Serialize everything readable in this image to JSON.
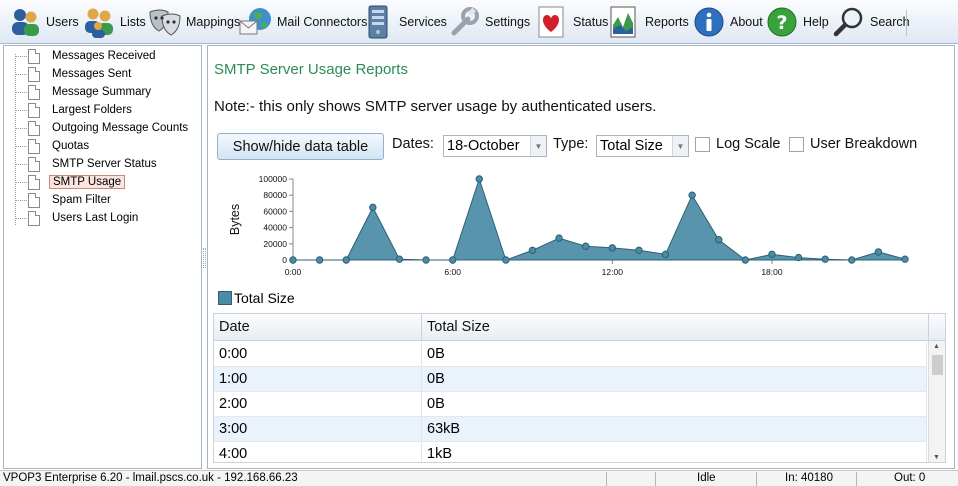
{
  "toolbar": {
    "items": [
      {
        "label": "Users",
        "icon": "users-icon"
      },
      {
        "label": "Lists",
        "icon": "lists-icon"
      },
      {
        "label": "Mappings",
        "icon": "masks-icon"
      },
      {
        "label": "Mail Connectors",
        "icon": "globe-mail-icon"
      },
      {
        "label": "Services",
        "icon": "server-icon"
      },
      {
        "label": "Settings",
        "icon": "wrench-icon"
      },
      {
        "label": "Status",
        "icon": "heart-icon"
      },
      {
        "label": "Reports",
        "icon": "report-chart-icon"
      },
      {
        "label": "About",
        "icon": "info-icon"
      },
      {
        "label": "Help",
        "icon": "help-icon"
      },
      {
        "label": "Search",
        "icon": "magnifier-icon"
      }
    ]
  },
  "tree": {
    "items": [
      {
        "label": "Messages Received"
      },
      {
        "label": "Messages Sent"
      },
      {
        "label": "Message Summary"
      },
      {
        "label": "Largest Folders"
      },
      {
        "label": "Outgoing Message Counts"
      },
      {
        "label": "Quotas"
      },
      {
        "label": "SMTP Server Status"
      },
      {
        "label": "SMTP Usage",
        "selected": true
      },
      {
        "label": "Spam Filter"
      },
      {
        "label": "Users Last Login"
      }
    ]
  },
  "main": {
    "title": "SMTP Server Usage Reports",
    "note": "Note:- this only shows SMTP server usage by authenticated users.",
    "toggle_button": "Show/hide data table",
    "dates_label": "Dates:",
    "dates_value": "18-October",
    "type_label": "Type:",
    "type_value": "Total Size",
    "log_scale_label": "Log Scale",
    "user_breakdown_label": "User Breakdown"
  },
  "chart_data": {
    "type": "area",
    "ylabel": "Bytes",
    "xlabel": "",
    "x_tick_labels": [
      "0:00",
      "6:00",
      "12:00",
      "18:00"
    ],
    "y_tick_labels": [
      "0",
      "20000",
      "40000",
      "60000",
      "80000",
      "100000"
    ],
    "ylim": [
      0,
      100000
    ],
    "legend_position": "bottom-left",
    "series": [
      {
        "name": "Total Size",
        "color": "#4a8ca6",
        "x": [
          "0:00",
          "1:00",
          "2:00",
          "3:00",
          "4:00",
          "5:00",
          "6:00",
          "7:00",
          "8:00",
          "9:00",
          "10:00",
          "11:00",
          "12:00",
          "13:00",
          "14:00",
          "15:00",
          "16:00",
          "17:00",
          "18:00",
          "19:00",
          "20:00",
          "21:00",
          "22:00",
          "23:00"
        ],
        "values": [
          0,
          0,
          0,
          65000,
          1000,
          0,
          0,
          100000,
          0,
          12000,
          27000,
          17000,
          15000,
          12000,
          7000,
          80000,
          25000,
          0,
          7000,
          3000,
          1000,
          0,
          10000,
          1000
        ]
      }
    ]
  },
  "table": {
    "headers": [
      "Date",
      "Total Size"
    ],
    "rows": [
      [
        "0:00",
        "0B"
      ],
      [
        "1:00",
        "0B"
      ],
      [
        "2:00",
        "0B"
      ],
      [
        "3:00",
        "63kB"
      ],
      [
        "4:00",
        "1kB"
      ]
    ]
  },
  "statusbar": {
    "app_info": "VPOP3 Enterprise 6.20 - lmail.pscs.co.uk - 192.168.66.23",
    "state": "Idle",
    "in": "In: 40180",
    "out": "Out: 0"
  }
}
